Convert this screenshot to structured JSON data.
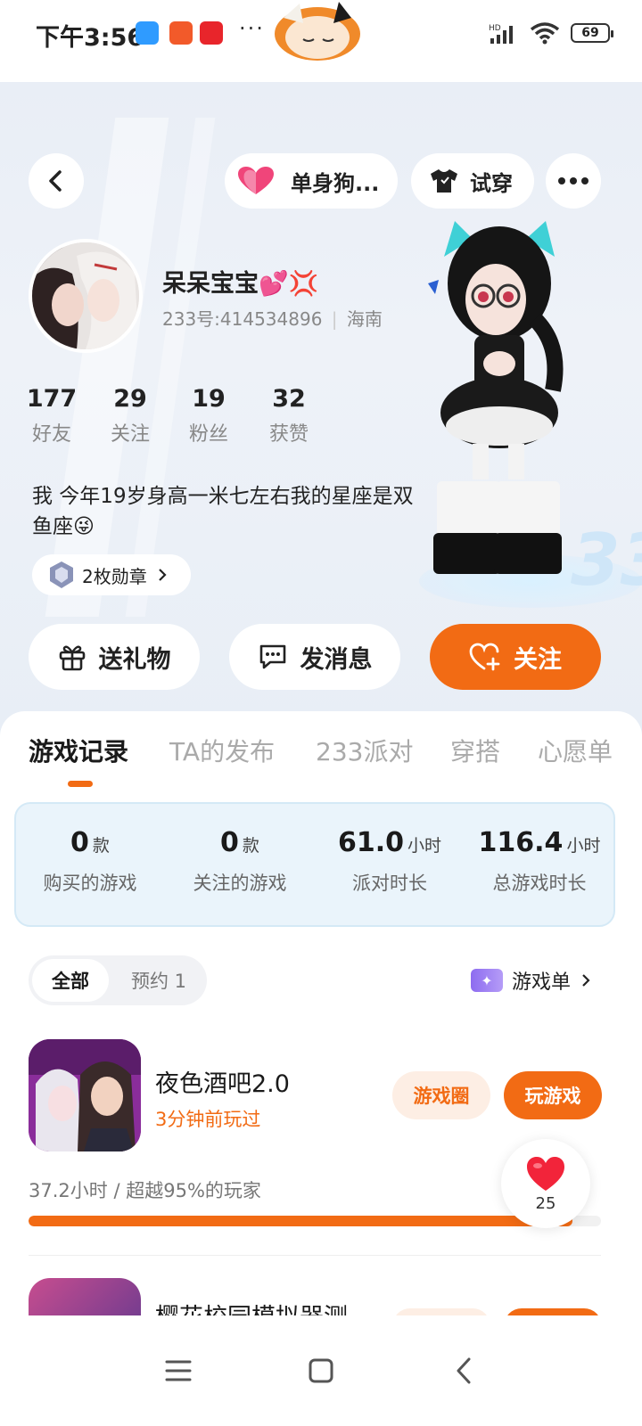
{
  "status_bar": {
    "time": "下午3:56",
    "battery": "69",
    "network": "HD"
  },
  "header": {
    "tag_label": "单身狗...",
    "try_on_label": "试穿"
  },
  "profile": {
    "username": "呆呆宝宝💕💢",
    "uid": "233号:414534896",
    "location": "海南",
    "stats": [
      {
        "value": "177",
        "label": "好友"
      },
      {
        "value": "29",
        "label": "关注"
      },
      {
        "value": "19",
        "label": "粉丝"
      },
      {
        "value": "32",
        "label": "获赞"
      }
    ],
    "bio": "我  今年19岁身高一米七左右我的星座是双鱼座😜",
    "badges_label": "2枚勋章"
  },
  "actions": {
    "gift": "送礼物",
    "message": "发消息",
    "follow": "关注"
  },
  "tabs": [
    "游戏记录",
    "TA的发布",
    "233派对",
    "穿搭",
    "心愿单"
  ],
  "summary": [
    {
      "value": "0",
      "unit": "款",
      "label": "购买的游戏"
    },
    {
      "value": "0",
      "unit": "款",
      "label": "关注的游戏"
    },
    {
      "value": "61.0",
      "unit": "小时",
      "label": "派对时长"
    },
    {
      "value": "116.4",
      "unit": "小时",
      "label": "总游戏时长"
    }
  ],
  "filter": {
    "all": "全部",
    "reserved": "预约 1",
    "game_list": "游戏单"
  },
  "games": [
    {
      "name": "夜色酒吧2.0",
      "last_played": "3分钟前玩过",
      "circle_label": "游戏圈",
      "play_label": "玩游戏",
      "hours": "37.2小时",
      "rank": "超越95%的玩家",
      "progress_fraction": 0.95
    },
    {
      "name": "樱花校园模拟器测"
    }
  ],
  "like_float": {
    "count": "25"
  },
  "colors": {
    "accent": "#f26b14",
    "accent_light": "#fdeee4",
    "summary_bg": "#eaf4fb"
  }
}
